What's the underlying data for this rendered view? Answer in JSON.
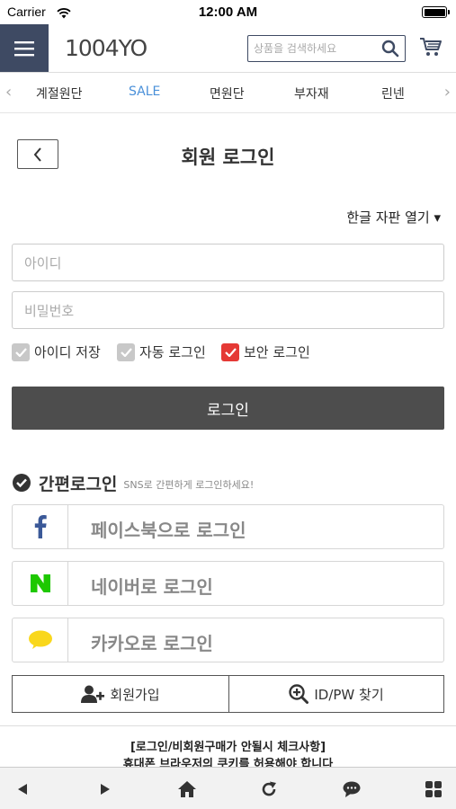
{
  "status_bar": {
    "carrier": "Carrier",
    "time": "12:00 AM"
  },
  "header": {
    "logo": "1004YO",
    "search_placeholder": "상품을 검색하세요"
  },
  "categories": [
    "계절원단",
    "SALE",
    "면원단",
    "부자재",
    "린넨"
  ],
  "page": {
    "title": "회원 로그인",
    "keyboard_toggle": "한글 자판 열기 ▾"
  },
  "form": {
    "id_placeholder": "아이디",
    "pw_placeholder": "비밀번호",
    "checks": [
      {
        "label": "아이디 저장",
        "checked": true,
        "color": "#c8c8c8"
      },
      {
        "label": "자동 로그인",
        "checked": true,
        "color": "#c8c8c8"
      },
      {
        "label": "보안 로그인",
        "checked": true,
        "color": "#e53935"
      }
    ],
    "login_label": "로그인"
  },
  "sns": {
    "title": "간편로그인",
    "subtitle": "SNS로 간편하게 로그인하세요!",
    "buttons": [
      {
        "label": "페이스북으로 로그인",
        "icon": "facebook-icon",
        "color": "#3b5998"
      },
      {
        "label": "네이버로 로그인",
        "icon": "naver-icon",
        "color": "#1ec800"
      },
      {
        "label": "카카오로 로그인",
        "icon": "kakao-icon",
        "color": "#f9d71c"
      }
    ]
  },
  "actions": {
    "join_label": "회원가입",
    "find_label": "ID/PW 찾기"
  },
  "notice": {
    "title": "[로그인/비회원구매가 안될시 체크사항]",
    "subtitle": "휴대폰 브라우저의 쿠키를 허용해야 합니다"
  },
  "colors": {
    "menu_bg": "#3e4a63",
    "sale": "#4a90d9",
    "login_btn": "#4d4d4d"
  }
}
